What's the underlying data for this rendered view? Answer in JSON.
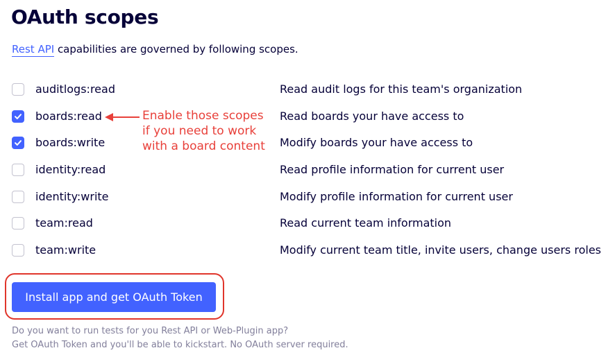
{
  "page": {
    "title": "OAuth scopes",
    "subtitle_link": "Rest API",
    "subtitle_text": " capabilities are governed by following scopes."
  },
  "scopes": [
    {
      "name": "auditlogs:read",
      "description": "Read audit logs for this team's organization",
      "checked": false
    },
    {
      "name": "boards:read",
      "description": "Read boards your have access to",
      "checked": true
    },
    {
      "name": "boards:write",
      "description": "Modify boards your have access to",
      "checked": true
    },
    {
      "name": "identity:read",
      "description": "Read profile information for current user",
      "checked": false
    },
    {
      "name": "identity:write",
      "description": "Modify profile information for current user",
      "checked": false
    },
    {
      "name": "team:read",
      "description": "Read current team information",
      "checked": false
    },
    {
      "name": "team:write",
      "description": "Modify current team title, invite users, change users roles",
      "checked": false
    }
  ],
  "annotation": {
    "lines": [
      "Enable those scopes",
      "if you need to work",
      "with a board content"
    ]
  },
  "install_button": {
    "label": "Install app and get OAuth Token"
  },
  "footer": {
    "line1": "Do you want to run tests for you Rest API or Web-Plugin app?",
    "line2": "Get OAuth Token and you'll be able to kickstart. No OAuth server required."
  },
  "colors": {
    "accent": "#4262ff",
    "text": "#050038",
    "muted": "#827f9b",
    "annotation": "#e8403a"
  }
}
